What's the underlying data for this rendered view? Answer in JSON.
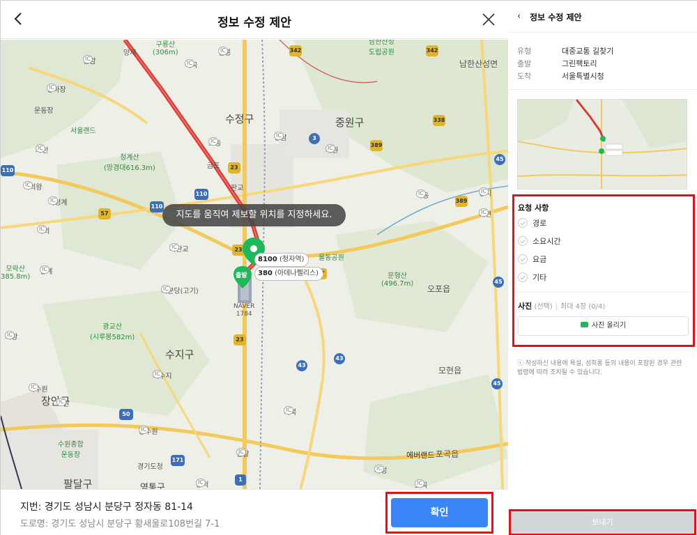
{
  "dialog": {
    "title": "정보 수정 제안"
  },
  "map": {
    "toast": "지도를 움직여 제보할 위치를 지정하세요.",
    "districts": [
      "수정구",
      "중원구",
      "수지구",
      "장안구",
      "팔달구",
      "오포읍",
      "모현읍",
      "포곡읍",
      "남한산성면",
      "영통구"
    ],
    "parks": [
      {
        "name": "청계산",
        "sub": "(망경대616.3m)"
      },
      {
        "name": "광교산",
        "sub": "(시루봉582m)"
      },
      {
        "name": "문형산",
        "sub": "(496.7m)"
      },
      {
        "name": "구룡산",
        "sub": "(306m)"
      },
      {
        "name": "모락산",
        "sub": "385.8m)"
      },
      {
        "name": "율동공원",
        "sub": ""
      },
      {
        "name": "서울랜드",
        "sub": ""
      },
      {
        "name": "남한산성",
        "sub": "도립공원"
      },
      {
        "name": "수원종합",
        "sub": "운동장"
      },
      {
        "name": "에버랜드",
        "sub": ""
      }
    ],
    "ics": [
      "선암",
      "양재",
      "헌릉",
      "내곡",
      "경마장",
      "운동장",
      "과천",
      "북의왕",
      "북청계",
      "청계",
      "학의",
      "서판교",
      "판교",
      "성남",
      "고등",
      "금토",
      "대원",
      "직동",
      "태전",
      "장지",
      "서분당(고기)",
      "의왕",
      "서수지",
      "북수원",
      "조원",
      "동수원",
      "신갈",
      "마북",
      "마성",
      "흥덕",
      "포곡",
      "경기도청"
    ],
    "stops": [
      {
        "number": "8100",
        "name": "(정자역)"
      },
      {
        "number": "380",
        "name": "(아데나펠리스)"
      }
    ],
    "start_label": "출발",
    "naver": "NAVER",
    "naver_num": "1784",
    "pin_color": "#1fb85a"
  },
  "footer": {
    "jibun": "지번: 경기도 성남시 분당구 정자동 81-14",
    "road": "도로명: 경기도 성남시 분당구 황새울로108번길 7-1",
    "confirm": "확인"
  },
  "panel": {
    "back": "‹",
    "title": "정보 수정 제안",
    "info": [
      {
        "key": "유형",
        "value": "대중교통 길찾기"
      },
      {
        "key": "출발",
        "value": "그린팩토리"
      },
      {
        "key": "도착",
        "value": "서울특별시청"
      }
    ],
    "request_heading": "요청 사항",
    "options": [
      "경로",
      "소요시간",
      "요금",
      "기타"
    ],
    "photo_label": "사진",
    "photo_optional": "(선택)",
    "photo_limit": "최대 4장 (0/4)",
    "upload": "사진 올리기",
    "notice": "ⓘ 작성하신 내용에 욕설, 성희롱 등의 내용이 포함된 경우 관련 법령에 따라 조치될 수 있습니다.",
    "send": "보내기"
  },
  "colors": {
    "accent": "#3a86f6",
    "highlight": "#e3101a",
    "route": "#d93a36",
    "disabled": "#d4d7da"
  }
}
